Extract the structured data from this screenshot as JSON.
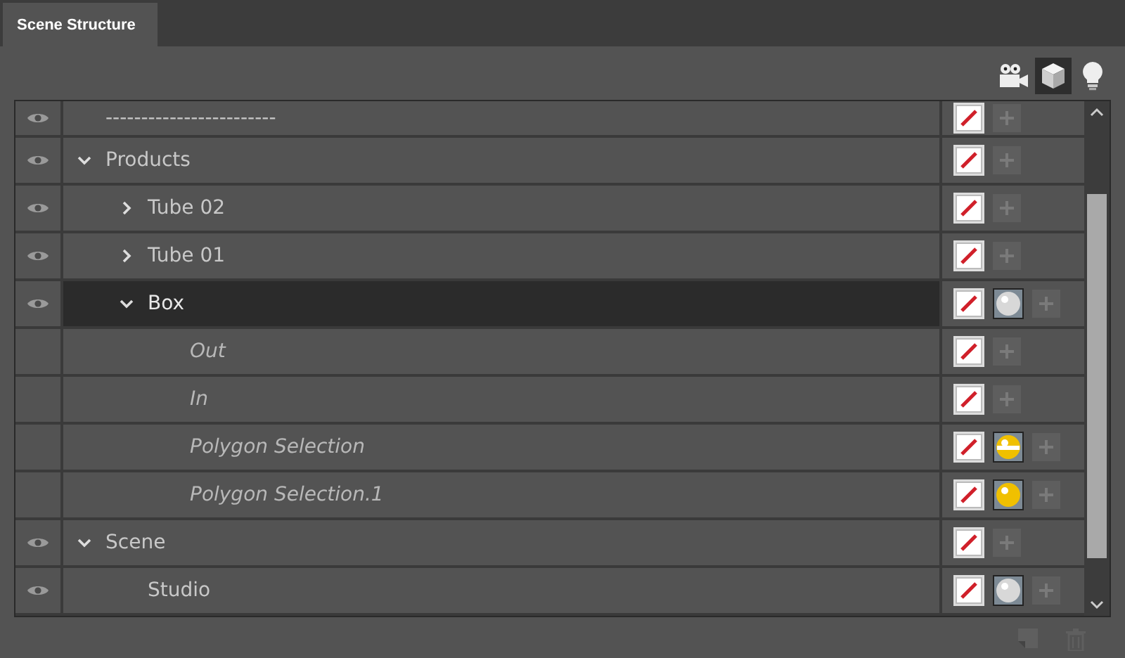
{
  "tab": {
    "label": "Scene Structure",
    "selected": true
  },
  "toolbar": [
    {
      "kind": "camera",
      "selected": false
    },
    {
      "kind": "cube",
      "selected": true
    },
    {
      "kind": "light",
      "selected": false
    }
  ],
  "tree": [
    {
      "name": "------------------------",
      "kind": "object",
      "visible": true,
      "selected": false
    },
    {
      "name": "Products",
      "kind": "object",
      "visible": true,
      "selected": false,
      "expanded": true,
      "children": [
        {
          "name": "Tube 02",
          "kind": "object",
          "visible": true,
          "selected": false,
          "expanded": false
        },
        {
          "name": "Tube 01",
          "kind": "object",
          "visible": true,
          "selected": false,
          "expanded": false
        },
        {
          "name": "Box",
          "kind": "object",
          "visible": true,
          "selected": true,
          "expanded": true,
          "material": {
            "color": "#d8d8d8",
            "striped": false
          },
          "children": [
            {
              "name": "Out",
              "kind": "selection",
              "visible": false,
              "selected": false
            },
            {
              "name": "In",
              "kind": "selection",
              "visible": false,
              "selected": false
            },
            {
              "name": "Polygon Selection",
              "kind": "selection",
              "visible": false,
              "selected": false,
              "material": {
                "color": "#f0c000",
                "striped": true
              }
            },
            {
              "name": "Polygon Selection.1",
              "kind": "selection",
              "visible": false,
              "selected": false,
              "material": {
                "color": "#f0c000",
                "striped": false
              }
            }
          ]
        }
      ]
    },
    {
      "name": "Scene",
      "kind": "object",
      "visible": true,
      "selected": false,
      "expanded": true,
      "children": [
        {
          "name": "Studio",
          "kind": "object",
          "visible": true,
          "selected": false,
          "material": {
            "color": "#d8d8d8",
            "striped": false
          }
        }
      ]
    }
  ]
}
